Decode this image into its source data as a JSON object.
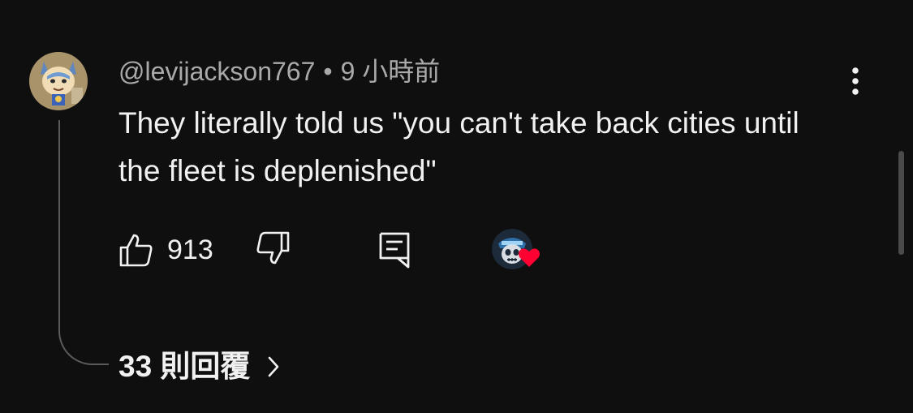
{
  "comment": {
    "author": "@levijackson767",
    "separator": "•",
    "time": "9 小時前",
    "text": "They literally told us \"you can't take back cities until the fleet is deplenished\"",
    "like_count": "913",
    "replies_label": "33 則回覆"
  },
  "icons": {
    "menu": "more-vertical-icon",
    "like": "thumbs-up-icon",
    "dislike": "thumbs-down-icon",
    "reply": "reply-icon",
    "heart": "heart-icon",
    "chevron": "chevron-right-icon"
  },
  "colors": {
    "background": "#0f0f0f",
    "text_primary": "#f1f1f1",
    "text_secondary": "#aaaaaa",
    "heart": "#ff0033",
    "thread_line": "#5a5a5a"
  }
}
